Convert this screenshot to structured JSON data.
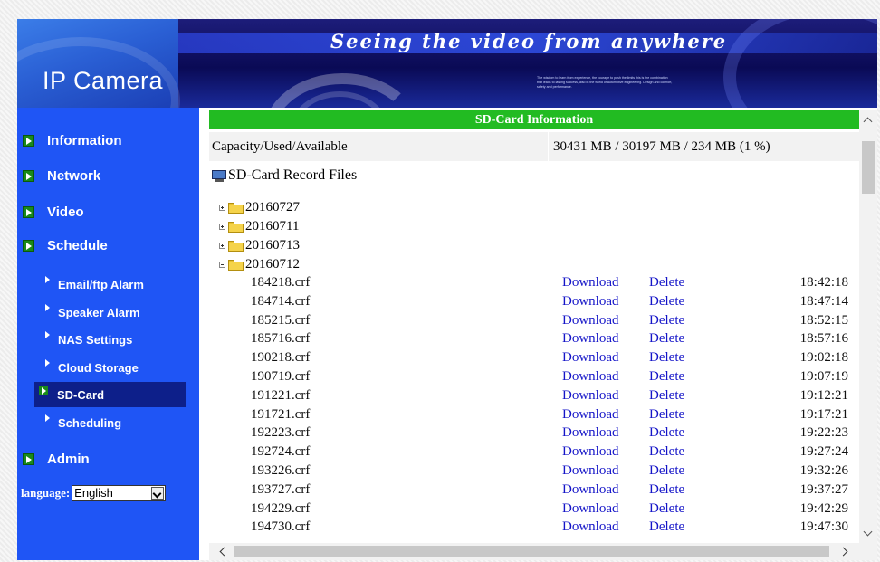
{
  "banner": {
    "product_name": "IP Camera",
    "slogan": "Seeing the video from anywhere",
    "blurb": "The wisdom to learn from experience, the courage to push the limits this is the combination that leads to lasting success, also in the world of automotive engineering. Design and comfort, safety and performance."
  },
  "sidebar": {
    "items": [
      {
        "label": "Information"
      },
      {
        "label": "Network"
      },
      {
        "label": "Video"
      },
      {
        "label": "Schedule"
      }
    ],
    "sub_items": [
      {
        "label": "Email/ftp Alarm"
      },
      {
        "label": "Speaker Alarm"
      },
      {
        "label": "NAS Settings"
      },
      {
        "label": "Cloud Storage"
      },
      {
        "label": "SD-Card"
      },
      {
        "label": "Scheduling"
      }
    ],
    "admin": {
      "label": "Admin"
    },
    "language": {
      "label": "language:",
      "value": "English"
    }
  },
  "main": {
    "title": "SD-Card Information",
    "capacity_label": "Capacity/Used/Available",
    "capacity_value": "30431 MB / 30197 MB / 234 MB (1 %)",
    "records_title": "SD-Card Record Files",
    "folders": [
      {
        "name": "20160727",
        "expanded": false
      },
      {
        "name": "20160711",
        "expanded": false
      },
      {
        "name": "20160713",
        "expanded": false
      },
      {
        "name": "20160712",
        "expanded": true
      }
    ],
    "download_label": "Download",
    "delete_label": "Delete",
    "files": [
      {
        "name": "184218.crf",
        "time": "18:42:18"
      },
      {
        "name": "184714.crf",
        "time": "18:47:14"
      },
      {
        "name": "185215.crf",
        "time": "18:52:15"
      },
      {
        "name": "185716.crf",
        "time": "18:57:16"
      },
      {
        "name": "190218.crf",
        "time": "19:02:18"
      },
      {
        "name": "190719.crf",
        "time": "19:07:19"
      },
      {
        "name": "191221.crf",
        "time": "19:12:21"
      },
      {
        "name": "191721.crf",
        "time": "19:17:21"
      },
      {
        "name": "192223.crf",
        "time": "19:22:23"
      },
      {
        "name": "192724.crf",
        "time": "19:27:24"
      },
      {
        "name": "193226.crf",
        "time": "19:32:26"
      },
      {
        "name": "193727.crf",
        "time": "19:37:27"
      },
      {
        "name": "194229.crf",
        "time": "19:42:29"
      },
      {
        "name": "194730.crf",
        "time": "19:47:30"
      }
    ]
  },
  "icons": {
    "nav_bullet": "green-arrow-icon",
    "sub_bullet": "white-triangle-icon",
    "folder": "folder-icon",
    "computer": "computer-icon"
  },
  "colors": {
    "sidebar_bg": "#1f55f5",
    "header_green": "#22bb22",
    "link_blue": "#1515c8",
    "active_item": "#0d1f8a"
  }
}
